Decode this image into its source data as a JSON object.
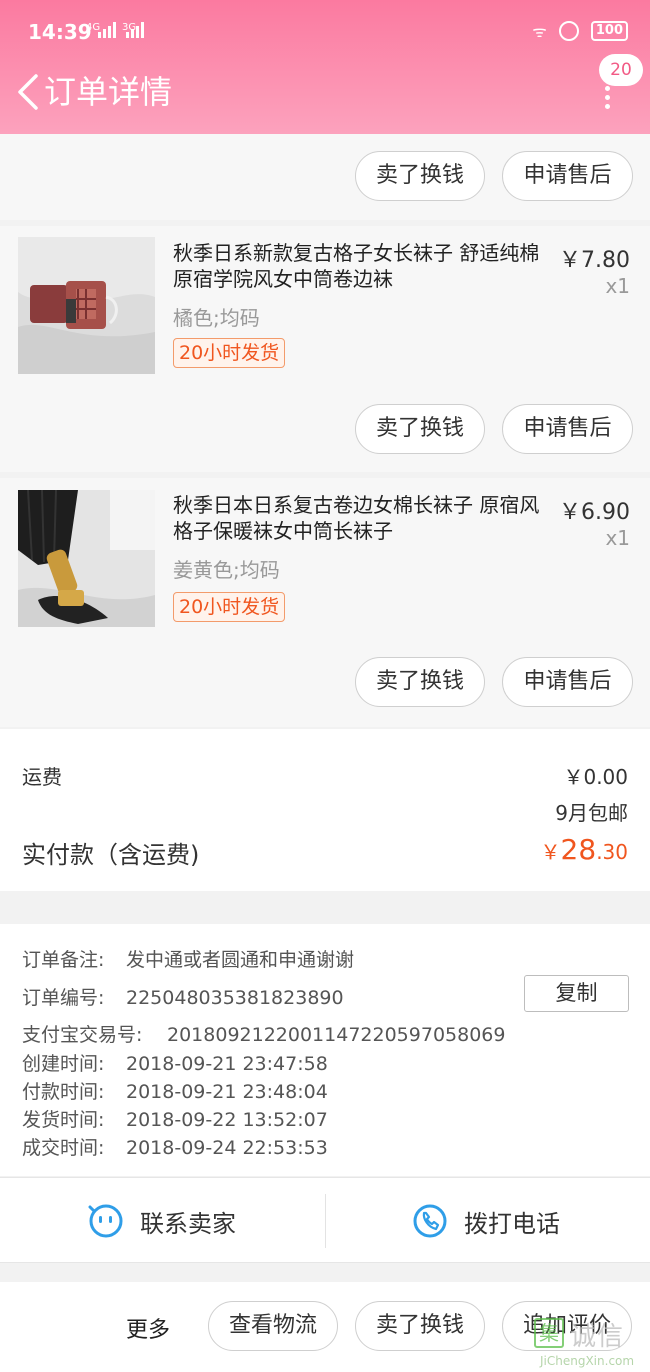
{
  "status_bar": {
    "time": "14:39",
    "signal_1": "4G",
    "signal_2": "3G",
    "battery": "100"
  },
  "header": {
    "title": "订单详情",
    "badge_count": "20"
  },
  "actions": {
    "sell_for_cash": "卖了换钱",
    "after_sale": "申请售后"
  },
  "items": [
    {
      "title": "秋季日系新款复古格子女长袜子 舒适纯棉原宿学院风女中筒卷边袜",
      "price": "￥7.80",
      "qty": "x1",
      "sku": "橘色;均码",
      "ship_tag": "20小时发货"
    },
    {
      "title": "秋季日本日系复古卷边女棉长袜子 原宿风格子保暖袜女中筒长袜子",
      "price": "￥6.90",
      "qty": "x1",
      "sku": "姜黄色;均码",
      "ship_tag": "20小时发货"
    }
  ],
  "summary": {
    "shipping_label": "运费",
    "shipping_value": "￥0.00",
    "shipping_note": "9月包邮",
    "paid_label": "实付款（含运费)",
    "paid_currency": "￥",
    "paid_int": "28",
    "paid_dec": ".30"
  },
  "order_info": {
    "note_label": "订单备注:",
    "note_value": "发中通或者圆通和申通谢谢",
    "order_no_label": "订单编号:",
    "order_no_value": "225048035381823890",
    "copy_label": "复制",
    "alipay_label": "支付宝交易号:",
    "alipay_value": "2018092122001147220597058069",
    "created_label": "创建时间:",
    "created_value": "2018-09-21 23:47:58",
    "paid_label": "付款时间:",
    "paid_value": "2018-09-21 23:48:04",
    "shipped_label": "发货时间:",
    "shipped_value": "2018-09-22 13:52:07",
    "done_label": "成交时间:",
    "done_value": "2018-09-24 22:53:53"
  },
  "contact": {
    "seller": "联系卖家",
    "call": "拨打电话"
  },
  "bottom_bar": {
    "more": "更多",
    "logistics": "查看物流",
    "sell_for_cash": "卖了换钱",
    "add_review": "追加评价"
  },
  "watermark": {
    "char": "集",
    "cn": "诚信",
    "en": "JiChengXin.com"
  },
  "colors": {
    "header_top": "#fb7aa0",
    "header_bottom": "#fca2bd",
    "accent_orange": "#f0561f",
    "icon_blue": "#2f9ee8"
  }
}
